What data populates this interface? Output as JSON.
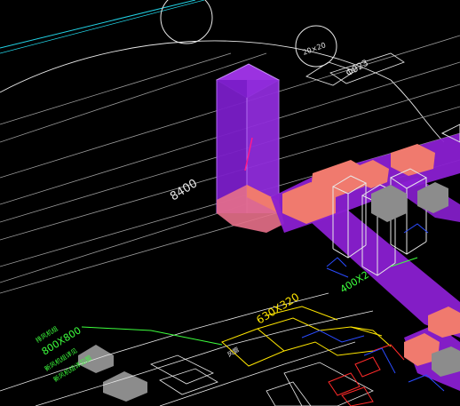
{
  "viewport": {
    "background": "#000000"
  },
  "colors": {
    "linework": "#e8e8e8",
    "grid_line": "#9a9a9a",
    "cyan_line": "#22d3e6",
    "duct_fill": "#8a1fd1",
    "duct_edge": "#b16cf0",
    "fitting": "#f07a6e",
    "equipment": "#8c8c8c",
    "green_text": "#3dff3d",
    "yellow": "#ffe600",
    "red": "#ff2a2a",
    "blue": "#2a4bff",
    "magenta": "#ff1a8c"
  },
  "annotations": {
    "dimension": "8400",
    "pipe_small": "20×20",
    "pipe_tag": "Φ923",
    "duct_size_1": "630X320",
    "duct_size_2": "400X2",
    "duct_size_3": "800X800",
    "green_note_1": "排风机组",
    "green_note_2": "新风机组详见",
    "green_note_3": "新风机组详见图",
    "white_small": "风管"
  }
}
